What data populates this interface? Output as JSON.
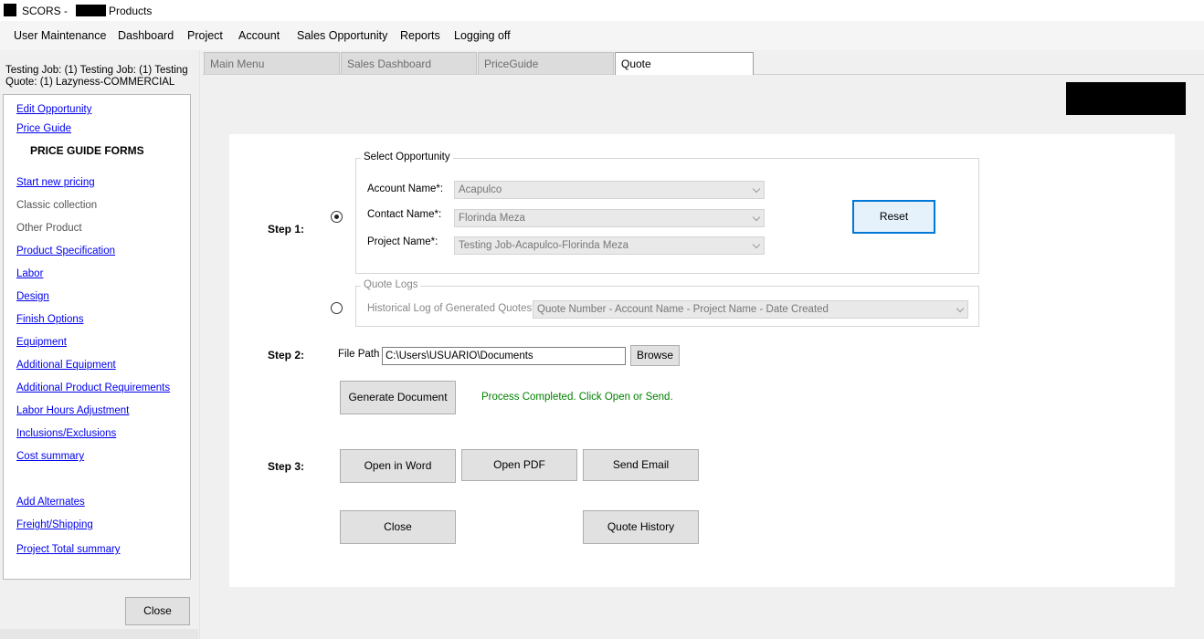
{
  "titlebar": {
    "app_name": "SCORS -",
    "title_suffix": "Products"
  },
  "menu": [
    "User Maintenance",
    "Dashboard",
    "Project",
    "Account",
    "Sales Opportunity",
    "Reports",
    "Logging off"
  ],
  "left": {
    "header_line1": "Testing Job: (1) Testing Job: (1) Testing",
    "header_line2": "Quote: (1) Lazyness-COMMERCIAL",
    "edit_opportunity": "Edit Opportunity",
    "price_guide": "Price Guide",
    "section_title": "PRICE GUIDE FORMS",
    "start_new_pricing": "Start new pricing",
    "classic_collection": "Classic collection",
    "other_product": "Other Product",
    "product_specification": "Product Specification",
    "labor": "Labor",
    "design": "Design",
    "finish_options": "Finish Options",
    "equipment": "Equipment",
    "additional_equipment": "Additional Equipment",
    "additional_product_requirements": "Additional Product Requirements",
    "labor_hours_adjustment": "Labor Hours Adjustment",
    "inclusions_exclusions": "Inclusions/Exclusions",
    "cost_summary": "Cost summary",
    "add_alternates": "Add Alternates",
    "freight_shipping": "Freight/Shipping",
    "project_total_summary": "Project Total summary",
    "close_label": "Close"
  },
  "tabs": [
    "Main Menu",
    "Sales Dashboard",
    "PriceGuide",
    "Quote"
  ],
  "quote": {
    "step1_label": "Step 1:",
    "step2_label": "Step 2:",
    "step3_label": "Step 3:",
    "select_opportunity": {
      "legend": "Select Opportunity",
      "account_label": "Account Name*:",
      "account_value": "Acapulco",
      "contact_label": "Contact Name*:",
      "contact_value": "Florinda Meza",
      "project_label": "Project Name*:",
      "project_value": "Testing Job-Acapulco-Florinda Meza",
      "reset_label": "Reset"
    },
    "quote_logs": {
      "legend": "Quote Logs",
      "history_label": "Historical Log of Generated Quotes*:",
      "history_value": "Quote Number  - Account Name  - Project Name - Date Created"
    },
    "file_path_label": "File Path",
    "file_path_value": "C:\\Users\\USUARIO\\Documents",
    "browse_label": "Browse",
    "generate_label": "Generate Document",
    "status_text": "Process Completed. Click Open or Send.",
    "open_word_label": "Open in Word",
    "open_pdf_label": "Open PDF",
    "send_email_label": "Send Email",
    "close_label": "Close",
    "quote_history_label": "Quote History"
  },
  "colors": {
    "link": "#0000ee",
    "status_ok": "#008000",
    "focus_border": "#0078d7"
  }
}
